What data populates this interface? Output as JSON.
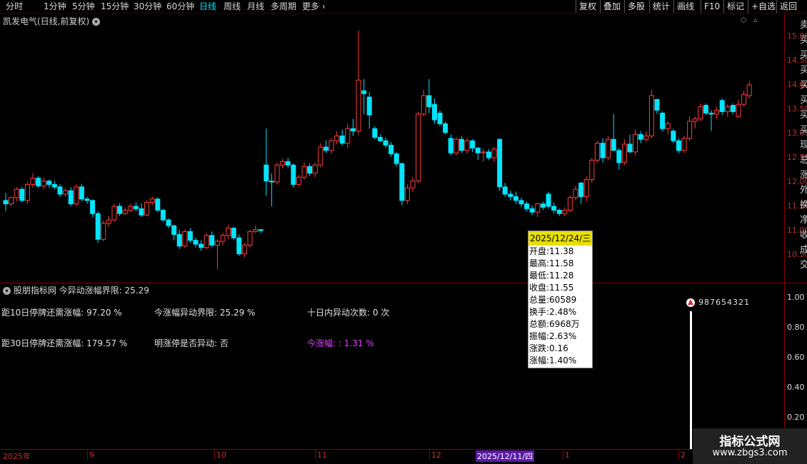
{
  "toolbar": {
    "periods": [
      "分时",
      "1分钟",
      "5分钟",
      "15分钟",
      "30分钟",
      "60分钟",
      "日线",
      "周线",
      "月线",
      "多周期",
      "更多"
    ],
    "active_period": "日线",
    "right_buttons": [
      "复权",
      "叠加",
      "多股",
      "统计",
      "画线",
      "F10",
      "标记",
      "+自选",
      "返回"
    ]
  },
  "stock_title": "凯发电气(日线,前复权)",
  "price_axis": [
    "15.00",
    "14.50",
    "14.00",
    "13.50",
    "13.00",
    "12.50",
    "12.00",
    "11.50",
    "11.00",
    "10.50"
  ],
  "indicator": {
    "header": "股朋指标网 今异动涨幅界限: 25.29",
    "row1": [
      "距10日停牌还需涨幅: 97.20 %",
      "今涨幅异动界限: 25.29 %",
      "十日内异动次数: 0 次"
    ],
    "row2": [
      "距30日停牌还需涨幅: 179.57 %",
      "明涨停是否异动: 否",
      "今涨幅: : 1.31 %"
    ],
    "axis": [
      "1.00",
      "0.80",
      "0.60",
      "0.40",
      "0.20"
    ],
    "marker_digits": "987654321"
  },
  "tooltip": {
    "date": "2025/12/24/三",
    "rows": [
      "开盘:11.38",
      "最高:11.58",
      "最低:11.28",
      "收盘:11.55",
      "总量:60589",
      "换手:2.48%",
      "总额:6968万",
      "振幅:2.63%",
      "涨跌:0.16",
      "涨幅:1.40%"
    ]
  },
  "date_axis": {
    "labels": [
      "2025年",
      "9",
      "10",
      "11",
      "12",
      "1",
      "2"
    ],
    "highlight": "2025/12/11/四"
  },
  "right_edge_chars": [
    "卖",
    "买",
    "买",
    "买",
    "买",
    "买",
    "买",
    "买",
    "现",
    "总",
    "涨",
    "外",
    "换",
    "净",
    "收",
    "成",
    "交"
  ],
  "watermark": {
    "title": "指标公式网",
    "url": "www.zbgs3.com"
  },
  "colors": {
    "up": "#ff3b3b",
    "down": "#00e5ff",
    "axis": "#8b0000",
    "active": "#00e5ff"
  },
  "chart_data": {
    "type": "candlestick",
    "ylim": [
      10.1,
      15.3
    ],
    "candles": [
      [
        11.62,
        11.78,
        11.4,
        11.55
      ],
      [
        11.55,
        11.7,
        11.5,
        11.68
      ],
      [
        11.68,
        11.9,
        11.6,
        11.85
      ],
      [
        11.85,
        11.9,
        11.58,
        11.62
      ],
      [
        11.62,
        12.0,
        11.55,
        11.95
      ],
      [
        11.95,
        12.18,
        11.88,
        12.08
      ],
      [
        12.08,
        12.12,
        11.88,
        11.92
      ],
      [
        11.92,
        12.1,
        11.85,
        12.02
      ],
      [
        12.02,
        12.05,
        11.88,
        11.95
      ],
      [
        11.95,
        12.02,
        11.85,
        11.9
      ],
      [
        11.9,
        11.96,
        11.7,
        11.75
      ],
      [
        11.75,
        11.88,
        11.7,
        11.82
      ],
      [
        11.82,
        11.9,
        11.5,
        11.55
      ],
      [
        11.55,
        11.95,
        11.5,
        11.9
      ],
      [
        11.9,
        11.96,
        11.6,
        11.65
      ],
      [
        11.65,
        11.7,
        11.55,
        11.62
      ],
      [
        11.62,
        11.64,
        11.28,
        11.35
      ],
      [
        11.35,
        11.4,
        10.75,
        10.82
      ],
      [
        10.82,
        11.2,
        10.78,
        11.15
      ],
      [
        11.15,
        11.3,
        11.08,
        11.22
      ],
      [
        11.22,
        11.55,
        11.18,
        11.5
      ],
      [
        11.5,
        11.56,
        11.3,
        11.35
      ],
      [
        11.35,
        11.48,
        11.32,
        11.42
      ],
      [
        11.42,
        11.55,
        11.38,
        11.5
      ],
      [
        11.5,
        11.58,
        11.4,
        11.45
      ],
      [
        11.45,
        11.56,
        11.28,
        11.32
      ],
      [
        11.32,
        11.62,
        11.3,
        11.58
      ],
      [
        11.58,
        11.7,
        11.52,
        11.65
      ],
      [
        11.65,
        11.68,
        11.38,
        11.42
      ],
      [
        11.42,
        11.45,
        11.18,
        11.22
      ],
      [
        11.22,
        11.25,
        11.05,
        11.1
      ],
      [
        11.1,
        11.12,
        10.8,
        10.92
      ],
      [
        10.92,
        11.02,
        10.62,
        10.68
      ],
      [
        10.68,
        11.02,
        10.65,
        10.98
      ],
      [
        10.98,
        11.05,
        10.75,
        10.8
      ],
      [
        10.8,
        10.86,
        10.65,
        10.72
      ],
      [
        10.72,
        10.8,
        10.58,
        10.65
      ],
      [
        10.65,
        10.95,
        10.62,
        10.9
      ],
      [
        10.9,
        10.98,
        10.65,
        10.7
      ],
      [
        10.7,
        10.82,
        10.2,
        10.78
      ],
      [
        10.78,
        10.95,
        10.7,
        10.9
      ],
      [
        10.9,
        11.12,
        10.82,
        11.05
      ],
      [
        11.05,
        11.08,
        10.8,
        10.85
      ],
      [
        10.85,
        10.92,
        10.48,
        10.52
      ],
      [
        10.52,
        10.75,
        10.45,
        10.7
      ],
      [
        10.7,
        11.02,
        10.65,
        10.98
      ],
      [
        10.98,
        11.1,
        10.95,
        11.02
      ],
      [
        11.02,
        11.0,
        10.95,
        11.0
      ],
      [
        12.35,
        13.1,
        11.72,
        12.02
      ],
      [
        12.02,
        12.18,
        11.5,
        12.0
      ],
      [
        12.0,
        12.4,
        11.95,
        12.35
      ],
      [
        12.35,
        12.48,
        12.28,
        12.42
      ],
      [
        12.42,
        12.5,
        12.3,
        12.35
      ],
      [
        12.35,
        12.38,
        11.88,
        11.95
      ],
      [
        11.95,
        12.15,
        11.9,
        12.1
      ],
      [
        12.1,
        12.4,
        12.05,
        12.32
      ],
      [
        12.32,
        12.38,
        12.12,
        12.18
      ],
      [
        12.18,
        12.4,
        12.1,
        12.35
      ],
      [
        12.35,
        12.8,
        12.3,
        12.72
      ],
      [
        12.72,
        12.86,
        12.6,
        12.65
      ],
      [
        12.65,
        12.9,
        12.58,
        12.85
      ],
      [
        12.85,
        13.05,
        12.78,
        12.95
      ],
      [
        12.95,
        13.08,
        12.75,
        12.8
      ],
      [
        12.8,
        13.2,
        12.7,
        13.1
      ],
      [
        13.1,
        13.3,
        12.95,
        13.05
      ],
      [
        13.05,
        15.12,
        12.98,
        14.1
      ],
      [
        13.88,
        14.12,
        13.4,
        13.82
      ],
      [
        13.75,
        13.85,
        13.1,
        13.38
      ],
      [
        13.1,
        13.15,
        12.88,
        12.92
      ],
      [
        12.92,
        12.98,
        12.82,
        12.85
      ],
      [
        12.85,
        12.92,
        12.7,
        12.76
      ],
      [
        12.76,
        12.82,
        12.52,
        12.58
      ],
      [
        12.58,
        12.62,
        12.32,
        12.38
      ],
      [
        12.38,
        12.4,
        11.52,
        11.62
      ],
      [
        11.62,
        11.95,
        11.55,
        11.88
      ],
      [
        11.88,
        12.1,
        11.8,
        12.02
      ],
      [
        12.02,
        13.45,
        11.98,
        13.4
      ],
      [
        13.4,
        13.9,
        13.35,
        13.78
      ],
      [
        13.78,
        14.12,
        13.42,
        13.55
      ],
      [
        13.6,
        13.72,
        13.2,
        13.28
      ],
      [
        13.42,
        13.48,
        13.15,
        13.2
      ],
      [
        13.2,
        13.25,
        12.98,
        13.02
      ],
      [
        12.9,
        12.98,
        12.55,
        12.6
      ],
      [
        12.6,
        12.92,
        12.55,
        12.88
      ],
      [
        12.88,
        12.95,
        12.6,
        12.65
      ],
      [
        12.65,
        12.9,
        12.58,
        12.85
      ],
      [
        12.85,
        12.88,
        12.62,
        12.7
      ],
      [
        12.7,
        12.72,
        12.45,
        12.6
      ],
      [
        12.6,
        12.68,
        12.42,
        12.62
      ],
      [
        12.62,
        12.68,
        12.45,
        12.5
      ],
      [
        12.5,
        12.72,
        12.42,
        12.68
      ],
      [
        12.88,
        12.9,
        11.82,
        11.9
      ],
      [
        11.9,
        11.98,
        11.7,
        11.75
      ],
      [
        11.75,
        11.82,
        11.62,
        11.7
      ],
      [
        11.7,
        11.8,
        11.55,
        11.62
      ],
      [
        11.62,
        11.68,
        11.48,
        11.55
      ],
      [
        11.55,
        11.6,
        11.4,
        11.45
      ],
      [
        11.45,
        11.52,
        11.32,
        11.38
      ],
      [
        11.38,
        11.58,
        11.28,
        11.55
      ],
      [
        11.55,
        11.6,
        11.42,
        11.48
      ],
      [
        11.75,
        11.8,
        11.45,
        11.5
      ],
      [
        11.5,
        11.58,
        11.35,
        11.42
      ],
      [
        11.42,
        11.45,
        11.3,
        11.35
      ],
      [
        11.35,
        11.48,
        11.3,
        11.42
      ],
      [
        11.42,
        11.72,
        11.38,
        11.68
      ],
      [
        11.68,
        11.92,
        11.62,
        11.85
      ],
      [
        11.98,
        12.0,
        11.55,
        11.7
      ],
      [
        11.7,
        12.12,
        11.6,
        12.05
      ],
      [
        12.05,
        12.5,
        11.98,
        12.45
      ],
      [
        12.45,
        12.85,
        12.4,
        12.8
      ],
      [
        12.8,
        12.9,
        12.4,
        12.5
      ],
      [
        12.5,
        12.95,
        12.45,
        12.88
      ],
      [
        12.88,
        13.4,
        12.8,
        12.65
      ],
      [
        12.65,
        12.7,
        12.25,
        12.4
      ],
      [
        12.4,
        12.88,
        12.35,
        12.78
      ],
      [
        12.78,
        12.98,
        12.6,
        12.62
      ],
      [
        12.62,
        13.08,
        12.55,
        12.98
      ],
      [
        12.98,
        13.05,
        12.8,
        12.88
      ],
      [
        12.88,
        13.05,
        12.82,
        12.95
      ],
      [
        12.95,
        13.9,
        12.9,
        13.78
      ],
      [
        13.7,
        13.72,
        13.4,
        13.48
      ],
      [
        13.42,
        13.45,
        13.05,
        13.1
      ],
      [
        13.1,
        13.25,
        12.98,
        13.2
      ],
      [
        13.05,
        13.1,
        12.8,
        12.85
      ],
      [
        12.85,
        12.9,
        12.6,
        12.65
      ],
      [
        12.65,
        12.95,
        12.6,
        12.9
      ],
      [
        12.9,
        13.35,
        12.85,
        13.25
      ],
      [
        13.25,
        13.35,
        13.1,
        13.3
      ],
      [
        13.3,
        13.62,
        13.25,
        13.55
      ],
      [
        13.58,
        13.62,
        13.38,
        13.42
      ],
      [
        13.42,
        13.48,
        13.05,
        13.4
      ],
      [
        13.4,
        13.55,
        13.3,
        13.48
      ],
      [
        13.68,
        13.72,
        13.38,
        13.45
      ],
      [
        13.45,
        13.6,
        13.35,
        13.55
      ],
      [
        13.58,
        13.62,
        13.4,
        13.45
      ],
      [
        13.35,
        13.7,
        13.32,
        13.6
      ],
      [
        13.6,
        13.88,
        13.55,
        13.8
      ],
      [
        13.78,
        14.08,
        13.72,
        14.0
      ]
    ]
  }
}
